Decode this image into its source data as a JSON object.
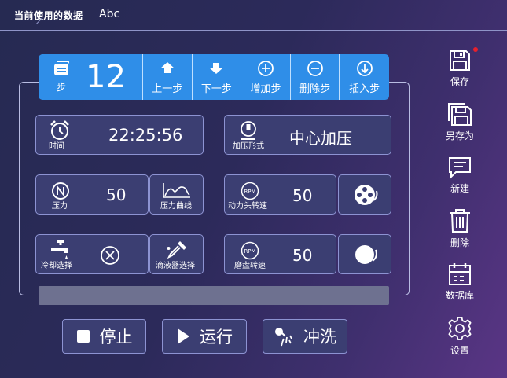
{
  "header": {
    "label": "当前使用的数据",
    "value": "Abc"
  },
  "stepbar": {
    "step_label": "步",
    "step_number": "12",
    "buttons": [
      {
        "icon": "arrow-up-icon",
        "label": "上一步"
      },
      {
        "icon": "arrow-down-icon",
        "label": "下一步"
      },
      {
        "icon": "plus-circle-icon",
        "label": "增加步"
      },
      {
        "icon": "minus-circle-icon",
        "label": "删除步"
      },
      {
        "icon": "arrow-down-circle-icon",
        "label": "插入步"
      }
    ]
  },
  "fields": {
    "time": {
      "caption": "时间",
      "value": "22:25:56",
      "icon": "alarm-clock-icon"
    },
    "press_mode": {
      "caption": "加压形式",
      "value": "中心加压",
      "icon": "press-icon"
    },
    "pressure": {
      "caption": "压力",
      "value": "50",
      "icon": "n-circle-icon"
    },
    "pressure_curve": {
      "caption": "压力曲线",
      "icon": "curve-icon"
    },
    "head_speed": {
      "caption": "动力头转速",
      "value": "50",
      "icon": "rpm-icon"
    },
    "cooling": {
      "caption": "冷却选择",
      "icon": "faucet-icon",
      "state_icon": "x-circle-icon"
    },
    "dropper": {
      "caption": "滴液器选择",
      "icon": "dropper-icon"
    },
    "disc_speed": {
      "caption": "磨盘转速",
      "value": "50",
      "icon": "rpm-icon"
    }
  },
  "sidebar": [
    {
      "icon": "floppy-icon",
      "label": "保存"
    },
    {
      "icon": "floppy-multi-icon",
      "label": "另存为"
    },
    {
      "icon": "message-icon",
      "label": "新建"
    },
    {
      "icon": "trash-icon",
      "label": "删除"
    },
    {
      "icon": "database-icon",
      "label": "数据库"
    },
    {
      "icon": "gear-icon",
      "label": "设置"
    }
  ],
  "controls": {
    "stop": "停止",
    "run": "运行",
    "rinse": "冲洗"
  },
  "colors": {
    "accent": "#2f8ee8",
    "alert": "#e8202c",
    "card": "#3b3e72"
  }
}
